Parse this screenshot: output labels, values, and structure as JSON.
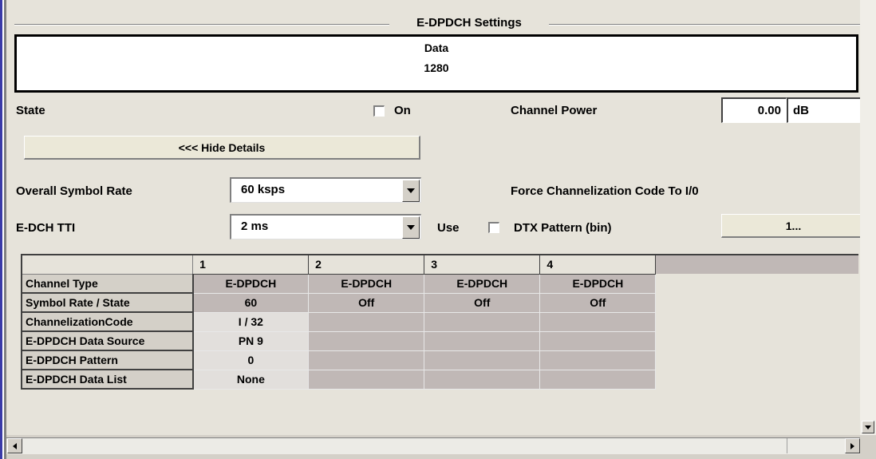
{
  "group": {
    "title": "E-DPDCH Settings"
  },
  "data_box": {
    "label": "Data",
    "value": "1280"
  },
  "state": {
    "label": "State",
    "checkbox_label": "On",
    "checked": false
  },
  "channel_power": {
    "label": "Channel Power",
    "value": "0.00",
    "unit": "dB"
  },
  "hide_details": {
    "label": "<<< Hide Details"
  },
  "overall_symbol_rate": {
    "label": "Overall Symbol Rate",
    "value": "60 ksps"
  },
  "force_channelization": {
    "label": "Force Channelization Code To I/0"
  },
  "edch_tti": {
    "label": "E-DCH TTI",
    "value": "2 ms"
  },
  "dtx": {
    "use_label": "Use",
    "label": "DTX Pattern (bin)",
    "button": "1...",
    "checked": false
  },
  "table": {
    "columns": [
      "1",
      "2",
      "3",
      "4"
    ],
    "rows": [
      {
        "header": "Channel Type",
        "cells": [
          "E-DPDCH",
          "E-DPDCH",
          "E-DPDCH",
          "E-DPDCH"
        ]
      },
      {
        "header": "Symbol Rate / State",
        "cells": [
          "60",
          "Off",
          "Off",
          "Off"
        ]
      },
      {
        "header": "ChannelizationCode",
        "cells": [
          "I / 32",
          "",
          "",
          ""
        ]
      },
      {
        "header": "E-DPDCH Data Source",
        "cells": [
          "PN 9",
          "",
          "",
          ""
        ]
      },
      {
        "header": "E-DPDCH Pattern",
        "cells": [
          "0",
          "",
          "",
          ""
        ]
      },
      {
        "header": "E-DPDCH Data List",
        "cells": [
          "None",
          "",
          "",
          ""
        ]
      }
    ]
  },
  "colors": {
    "panel": "#e6e3da",
    "cell_dark": "#c0b8b6",
    "cell_light": "#e2dfdc",
    "window_edge": "#3a3aa8"
  }
}
